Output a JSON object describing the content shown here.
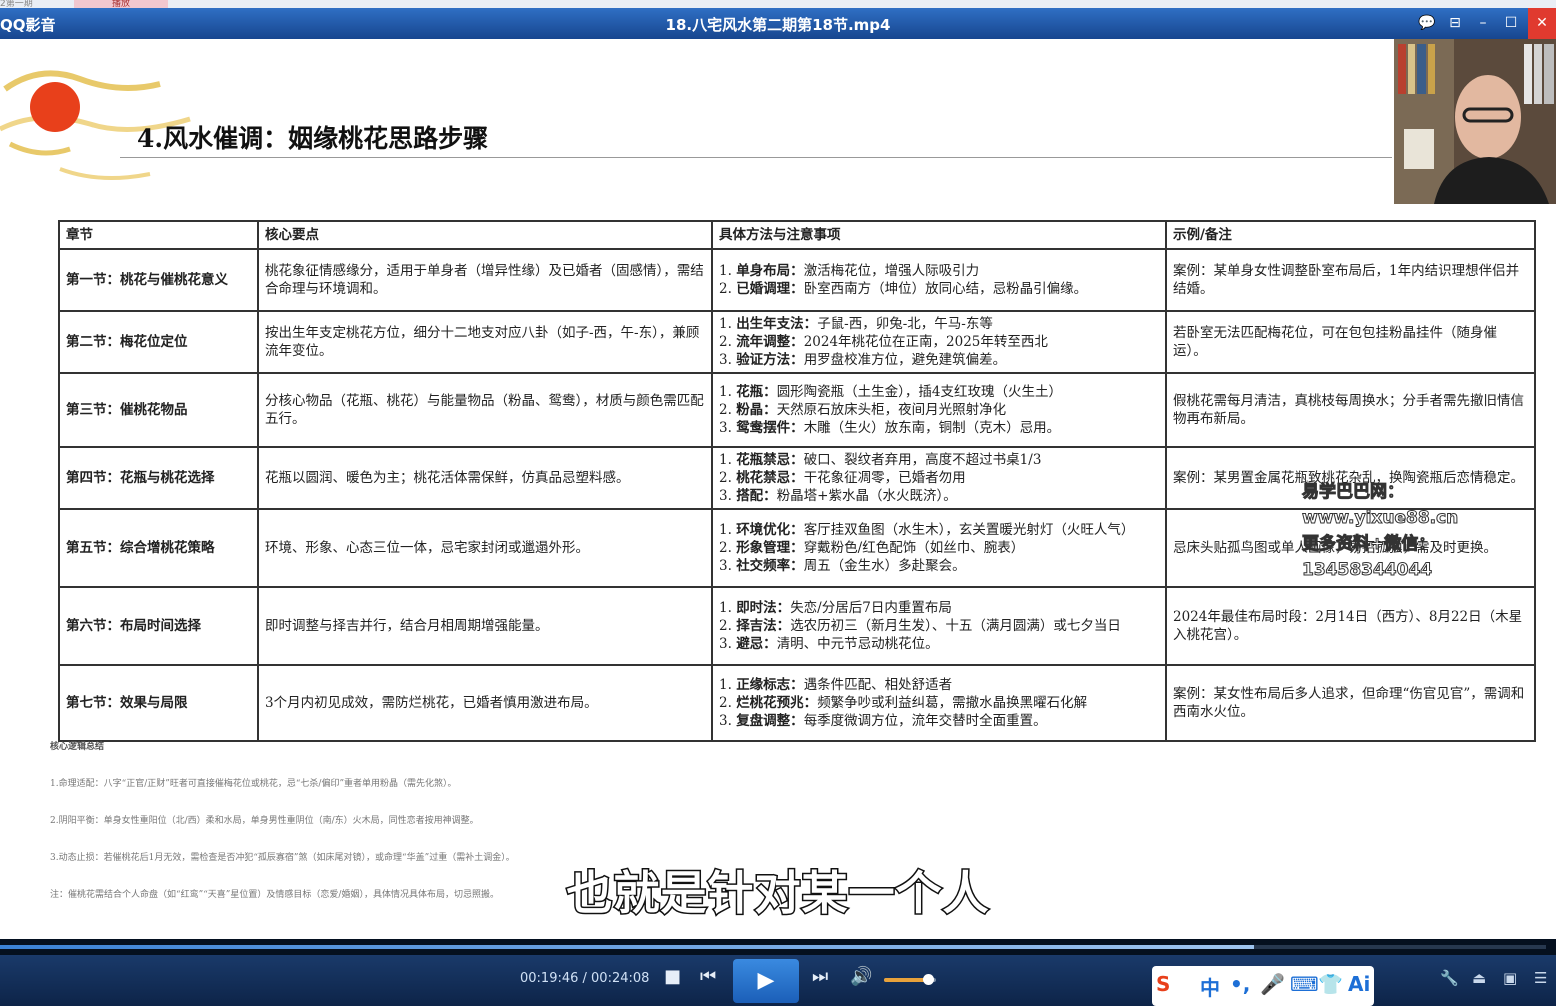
{
  "top_tabs": [
    "2第一期",
    "播放"
  ],
  "window": {
    "app_name": "QQ影音",
    "file_title": "18.八宅风水第二期第18节.mp4",
    "controls": [
      "💬",
      "⊟",
      "–",
      "☐",
      "✕"
    ]
  },
  "slide": {
    "title": "4.风水催调：姻缘桃花思路步骤",
    "table": {
      "headers": [
        "章节",
        "核心要点",
        "具体方法与注意事项",
        "示例/备注"
      ],
      "rows": [
        {
          "section": "第一节：桃花与催桃花意义",
          "core": "桃花象征情感缘分，适用于单身者（增异性缘）及已婚者（固感情），需结合命理与环境调和。",
          "methods": [
            {
              "num": "1.",
              "label": "单身布局：",
              "text": "激活梅花位，增强人际吸引力"
            },
            {
              "num": "2.",
              "label": "已婚调理：",
              "text": "卧室西南方（坤位）放同心结，忌粉晶引偏缘。"
            }
          ],
          "note": "案例：某单身女性调整卧室布局后，1年内结识理想伴侣并结婚。"
        },
        {
          "section": "第二节：梅花位定位",
          "core": "按出生年支定桃花方位，细分十二地支对应八卦（如子-西，午-东），兼顾流年变位。",
          "methods": [
            {
              "num": "1.",
              "label": "出生年支法：",
              "text": "子鼠-西，卯兔-北，午马-东等"
            },
            {
              "num": "2.",
              "label": "流年调整：",
              "text": "2024年桃花位在正南，2025年转至西北"
            },
            {
              "num": "3.",
              "label": "验证方法：",
              "text": "用罗盘校准方位，避免建筑偏差。"
            }
          ],
          "note": "若卧室无法匹配梅花位，可在包包挂粉晶挂件（随身催运）。"
        },
        {
          "section": "第三节：催桃花物品",
          "core": "分核心物品（花瓶、桃花）与能量物品（粉晶、鸳鸯），材质与颜色需匹配五行。",
          "methods": [
            {
              "num": "1.",
              "label": "花瓶：",
              "text": "圆形陶瓷瓶（土生金），插4支红玫瑰（火生土）"
            },
            {
              "num": "2.",
              "label": "粉晶：",
              "text": "天然原石放床头柜，夜间月光照射净化"
            },
            {
              "num": "3.",
              "label": "鸳鸯摆件：",
              "text": "木雕（生火）放东南，铜制（克木）忌用。"
            }
          ],
          "note": "假桃花需每月清洁，真桃枝每周换水；分手者需先撤旧情信物再布新局。"
        },
        {
          "section": "第四节：花瓶与桃花选择",
          "core": "花瓶以圆润、暖色为主；桃花活体需保鲜，仿真品忌塑料感。",
          "methods": [
            {
              "num": "1.",
              "label": "花瓶禁忌：",
              "text": "破口、裂纹者弃用，高度不超过书桌1/3"
            },
            {
              "num": "2.",
              "label": "桃花禁忌：",
              "text": "干花象征凋零，已婚者勿用"
            },
            {
              "num": "3.",
              "label": "搭配：",
              "text": "粉晶塔+紫水晶（水火既济）。"
            }
          ],
          "note": "案例：某男置金属花瓶致桃花杂乱，换陶瓷瓶后恋情稳定。"
        },
        {
          "section": "第五节：综合增桃花策略",
          "core": "环境、形象、心态三位一体，忌宅家封闭或邋遢外形。",
          "methods": [
            {
              "num": "1.",
              "label": "环境优化：",
              "text": "客厅挂双鱼图（水生木），玄关置暖光射灯（火旺人气）"
            },
            {
              "num": "2.",
              "label": "形象管理：",
              "text": "穿戴粉色/红色配饰（如丝巾、腕表）"
            },
            {
              "num": "3.",
              "label": "社交频率：",
              "text": "周五（金生水）多赴聚会。"
            }
          ],
          "note": "忌床头贴孤鸟图或单人画像，易招孤独，需及时更换。"
        },
        {
          "section": "第六节：布局时间选择",
          "core": "即时调整与择吉并行，结合月相周期增强能量。",
          "methods": [
            {
              "num": "1.",
              "label": "即时法：",
              "text": "失恋/分居后7日内重置布局"
            },
            {
              "num": "2.",
              "label": "择吉法：",
              "text": "选农历初三（新月生发）、十五（满月圆满）或七夕当日"
            },
            {
              "num": "3.",
              "label": "避忌：",
              "text": "清明、中元节忌动桃花位。"
            }
          ],
          "note": "2024年最佳布局时段：2月14日（西方）、8月22日（木星入桃花宫）。"
        },
        {
          "section": "第七节：效果与局限",
          "core": "3个月内初见成效，需防烂桃花，已婚者慎用激进布局。",
          "methods": [
            {
              "num": "1.",
              "label": "正缘标志：",
              "text": "遇条件匹配、相处舒适者"
            },
            {
              "num": "2.",
              "label": "烂桃花预兆：",
              "text": "频繁争吵或利益纠葛，需撤水晶换黑曜石化解"
            },
            {
              "num": "3.",
              "label": "复盘调整：",
              "text": "每季度微调方位，流年交替时全面重置。"
            }
          ],
          "note": "案例：某女性布局后多人追求，但命理“伤官见官”，需调和西南水火位。"
        }
      ]
    },
    "summary": {
      "heading": "核心逻辑总结",
      "lines": [
        "1.命理适配：八字“正官/正财”旺者可直接催梅花位或桃花，忌“七杀/偏印”重者单用粉晶（需先化煞）。",
        "2.阴阳平衡：单身女性重阳位（北/西）柔和水局，单身男性重阴位（南/东）火木局，同性恋者按用神调整。",
        "3.动态止损：若催桃花后1月无效，需检查是否冲犯“孤辰寡宿”煞（如床尾对镜），或命理“华盖”过重（需补土调金）。",
        "注：催桃花需结合个人命盘（如“红鸾”“天喜”星位置）及情感目标（恋爱/婚姻），具体情况具体布局，切忌照搬。"
      ]
    }
  },
  "watermark": {
    "line1": "易学巴巴网：www.yixue88.cn",
    "line2": "更多资料+微信：13458344044"
  },
  "subtitle": "也就是针对某一个人",
  "player": {
    "time_display": "00:19:46 / 00:24:08",
    "progress_fraction": 0.811,
    "volume_fraction": 0.85,
    "ime_label": "中",
    "ime_ai": "Ai"
  },
  "colors": {
    "titlebar": "#2f6fc4",
    "sun": "#e8401b",
    "progress": "#3b82d6",
    "volume": "#e8a23b"
  }
}
